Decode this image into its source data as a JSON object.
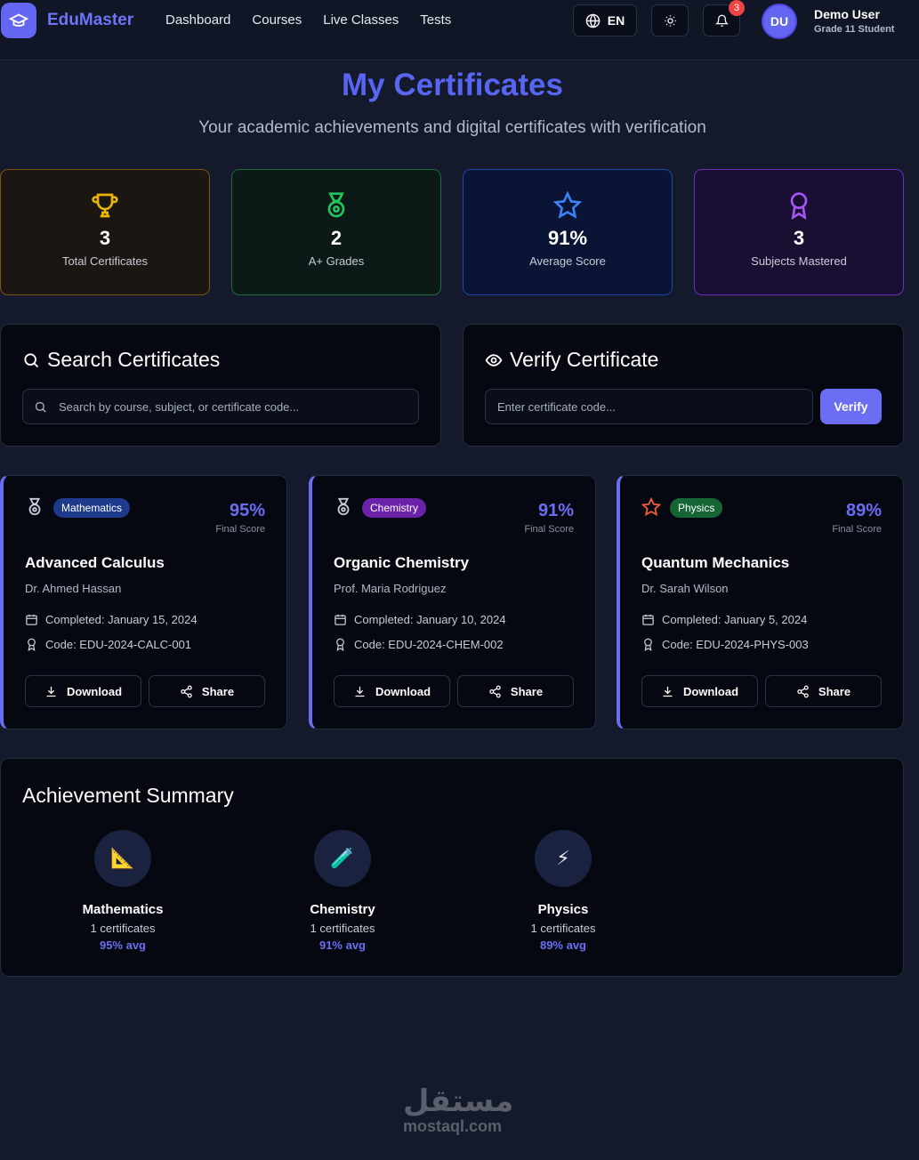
{
  "header": {
    "brand": "EduMaster",
    "nav": [
      "Dashboard",
      "Courses",
      "Live Classes",
      "Tests"
    ],
    "language": "EN",
    "notification_count": "3",
    "avatar_initials": "DU",
    "user_name": "Demo User",
    "user_role": "Grade 11 Student"
  },
  "page": {
    "title": "My Certificates",
    "subtitle": "Your academic achievements and digital certificates with verification"
  },
  "stats": [
    {
      "value": "3",
      "label": "Total Certificates",
      "icon": "trophy-icon",
      "color": "#eab308"
    },
    {
      "value": "2",
      "label": "A+ Grades",
      "icon": "medal-icon",
      "color": "#22c55e"
    },
    {
      "value": "91%",
      "label": "Average Score",
      "icon": "star-icon",
      "color": "#3b82f6"
    },
    {
      "value": "3",
      "label": "Subjects Mastered",
      "icon": "award-icon",
      "color": "#a855f7"
    }
  ],
  "search": {
    "title": "Search Certificates",
    "placeholder": "Search by course, subject, or certificate code..."
  },
  "verify": {
    "title": "Verify Certificate",
    "placeholder": "Enter certificate code...",
    "button": "Verify"
  },
  "certificates": [
    {
      "subject": "Mathematics",
      "subject_color": "#1e40af",
      "score": "95%",
      "score_label": "Final Score",
      "course": "Advanced Calculus",
      "teacher": "Dr. Ahmed Hassan",
      "completed": "Completed: January 15, 2024",
      "code": "Code: EDU-2024-CALC-001",
      "download": "Download",
      "share": "Share",
      "icon": "medal-icon"
    },
    {
      "subject": "Chemistry",
      "subject_color": "#6b21a8",
      "score": "91%",
      "score_label": "Final Score",
      "course": "Organic Chemistry",
      "teacher": "Prof. Maria Rodriguez",
      "completed": "Completed: January 10, 2024",
      "code": "Code: EDU-2024-CHEM-002",
      "download": "Download",
      "share": "Share",
      "icon": "medal-icon"
    },
    {
      "subject": "Physics",
      "subject_color": "#166534",
      "score": "89%",
      "score_label": "Final Score",
      "course": "Quantum Mechanics",
      "teacher": "Dr. Sarah Wilson",
      "completed": "Completed: January 5, 2024",
      "code": "Code: EDU-2024-PHYS-003",
      "download": "Download",
      "share": "Share",
      "icon": "star-icon"
    }
  ],
  "summary": {
    "title": "Achievement Summary",
    "subjects": [
      {
        "name": "Mathematics",
        "count": "1 certificates",
        "avg": "95% avg",
        "emoji": "📐"
      },
      {
        "name": "Chemistry",
        "count": "1 certificates",
        "avg": "91% avg",
        "emoji": "🧪"
      },
      {
        "name": "Physics",
        "count": "1 certificates",
        "avg": "89% avg",
        "emoji": "⚡"
      }
    ]
  },
  "watermark": {
    "arabic": "مستقل",
    "latin": "mostaql.com"
  }
}
